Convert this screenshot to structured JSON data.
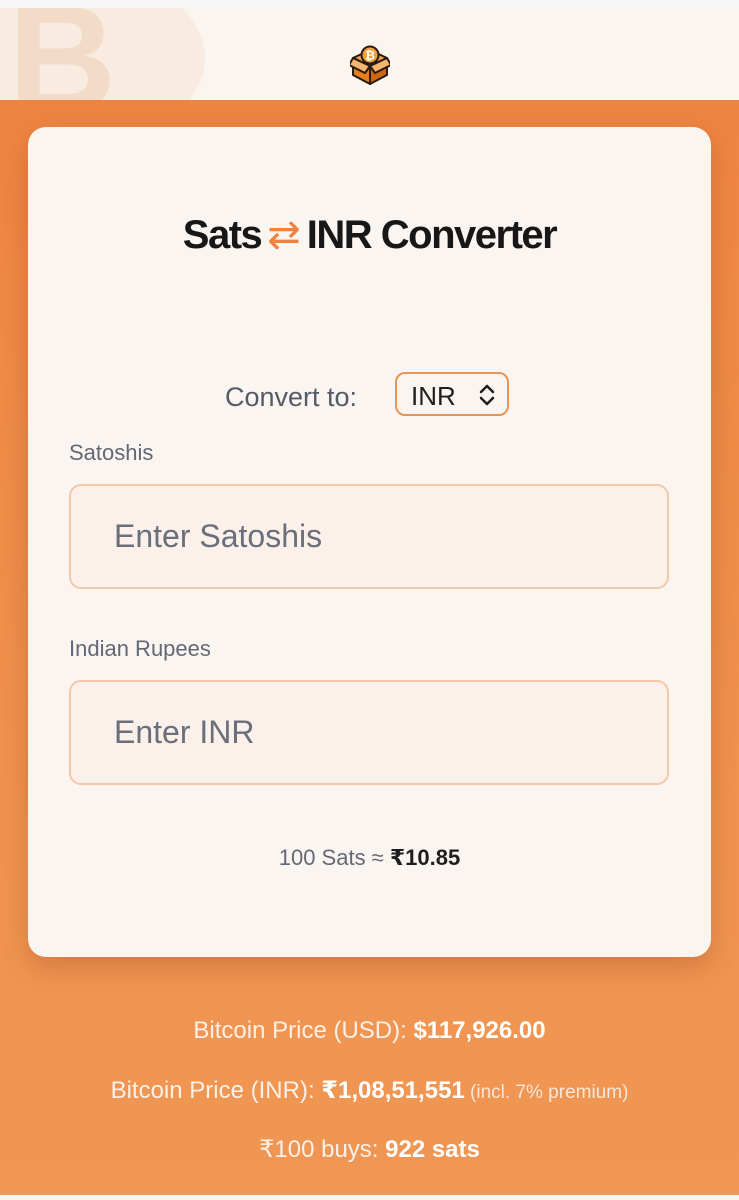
{
  "header": {
    "background_letter": "B",
    "logo_icon": "bitcoin-box-icon"
  },
  "converter": {
    "title_left": "Sats",
    "swap_symbol": "⇄",
    "title_right": "INR Converter",
    "convert_to_label": "Convert to:",
    "currency_selected": "INR",
    "sats_label": "Satoshis",
    "sats_placeholder": "Enter Satoshis",
    "inr_label": "Indian Rupees",
    "inr_placeholder": "Enter INR",
    "rate_prefix": "100 Sats ≈ ",
    "rate_value": "₹10.85"
  },
  "stats": {
    "usd_label": "Bitcoin Price (USD): ",
    "usd_value": "$117,926.00",
    "inr_label": "Bitcoin Price (INR): ",
    "inr_value": "₹1,08,51,551",
    "inr_note": " (incl. 7% premium)",
    "buys_label": "₹100 buys: ",
    "buys_value": "922 sats"
  },
  "colors": {
    "accent": "#ef8442",
    "card_bg": "#fbf5f1",
    "input_border": "#f3c8a7",
    "select_border": "#e79457",
    "title_text": "#171717"
  }
}
